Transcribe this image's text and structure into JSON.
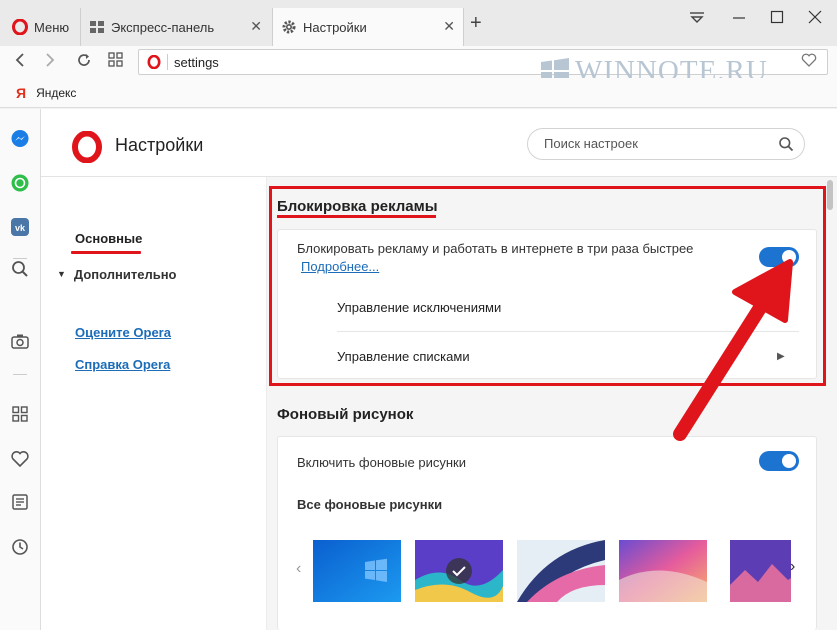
{
  "tabs": [
    {
      "label": "Меню",
      "icon": "opera-logo-icon"
    },
    {
      "label": "Экспресс-панель",
      "icon": "grid-icon"
    },
    {
      "label": "Настройки",
      "icon": "gear-icon",
      "active": true
    }
  ],
  "address": {
    "url": "settings"
  },
  "watermark": "WINNOTE.RU",
  "bookmarks": [
    {
      "label": "Яндекс",
      "icon_char": "Я"
    }
  ],
  "sidebar_icons": [
    "messenger-icon",
    "whatsapp-icon",
    "vk-icon",
    "search-icon",
    "camera-icon",
    "grid-icon",
    "heart-icon",
    "news-icon",
    "history-icon"
  ],
  "header": {
    "title": "Настройки",
    "search_placeholder": "Поиск настроек"
  },
  "leftnav": {
    "basic": "Основные",
    "advanced": "Дополнительно",
    "links": [
      "Оцените Opera",
      "Справка Opera"
    ]
  },
  "adblock": {
    "title": "Блокировка рекламы",
    "toggle_label": "Блокировать рекламу и работать в интернете в три раза быстрее",
    "more_link": "Подробнее...",
    "enabled": true,
    "rows": [
      "Управление исключениями",
      "Управление списками"
    ]
  },
  "background": {
    "title": "Фоновый рисунок",
    "toggle_label": "Включить фоновые рисунки",
    "enabled": true,
    "all_label": "Все фоновые рисунки"
  },
  "colors": {
    "accent": "#1c73d0",
    "annotation": "#e0151b",
    "opera_red": "#e0151b",
    "link": "#1c6cb8"
  }
}
